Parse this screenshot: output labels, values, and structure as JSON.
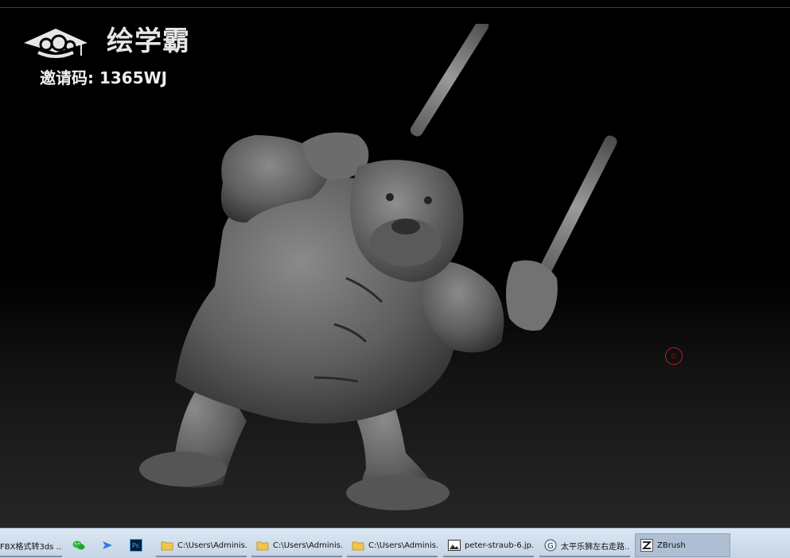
{
  "watermark": {
    "logo_text": "绘学霸",
    "invite_code": "邀请码: 1365WJ"
  },
  "viewport": {
    "subject": "bulldog-kungfu-sculpt",
    "background_color": "#000000",
    "cursor_ring_color": "#c02020"
  },
  "taskbar": {
    "items": [
      {
        "label": "FBX格式转3ds ...",
        "icon": "file-icon"
      },
      {
        "label": "",
        "icon": "wechat-icon"
      },
      {
        "label": "",
        "icon": "feishu-icon"
      },
      {
        "label": "",
        "icon": "photoshop-icon"
      },
      {
        "label": "C:\\Users\\Adminis...",
        "icon": "folder-icon"
      },
      {
        "label": "C:\\Users\\Adminis...",
        "icon": "folder-icon"
      },
      {
        "label": "C:\\Users\\Adminis...",
        "icon": "folder-icon"
      },
      {
        "label": "peter-straub-6.jp...",
        "icon": "image-icon"
      },
      {
        "label": "太平乐狮左右走路....",
        "icon": "3dsmax-icon"
      },
      {
        "label": "ZBrush",
        "icon": "zbrush-icon"
      }
    ],
    "active_item": "ZBrush",
    "colors": {
      "bar": "#c6d5e6",
      "active": "#aebfd4"
    }
  }
}
